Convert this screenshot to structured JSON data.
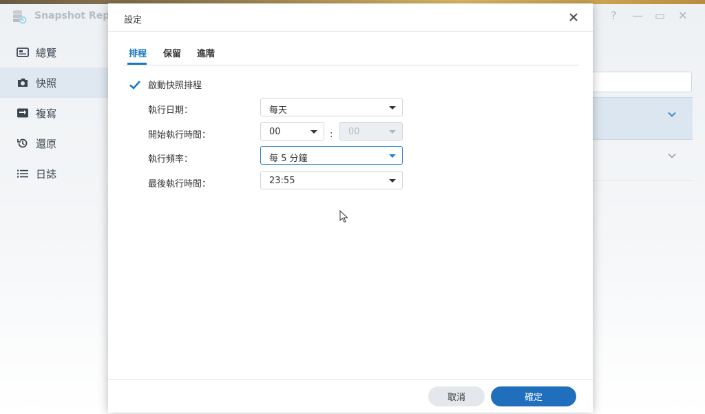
{
  "app": {
    "title": "Snapshot Replic",
    "window_controls": [
      "?",
      "—",
      "▭",
      "✕"
    ]
  },
  "sidebar": {
    "items": [
      {
        "label": "總覽",
        "icon": "overview-icon",
        "active": false
      },
      {
        "label": "快照",
        "icon": "camera-icon",
        "active": true
      },
      {
        "label": "複寫",
        "icon": "replication-icon",
        "active": false
      },
      {
        "label": "還原",
        "icon": "restore-icon",
        "active": false
      },
      {
        "label": "日誌",
        "icon": "log-list-icon",
        "active": false
      }
    ]
  },
  "dialog": {
    "title": "設定",
    "tabs": [
      {
        "label": "排程",
        "active": true
      },
      {
        "label": "保留",
        "active": false
      },
      {
        "label": "進階",
        "active": false
      }
    ],
    "enable_schedule": {
      "label": "啟動快照排程",
      "checked": true
    },
    "fields": {
      "run_date": {
        "label": "執行日期：",
        "value": "每天"
      },
      "start_time": {
        "label": "開始執行時間：",
        "hour": "00",
        "separator": ":",
        "minute": "00"
      },
      "frequency": {
        "label": "執行頻率：",
        "value": "每 5 分鐘"
      },
      "last_run_time": {
        "label": "最後執行時間：",
        "value": "23:55"
      }
    },
    "buttons": {
      "cancel": "取消",
      "ok": "確定"
    }
  },
  "colors": {
    "accent": "#1a78c2",
    "primary_button": "#1f6fbd",
    "active_sidebar": "#dfe7f0",
    "selected_row": "#dbe6f1"
  }
}
